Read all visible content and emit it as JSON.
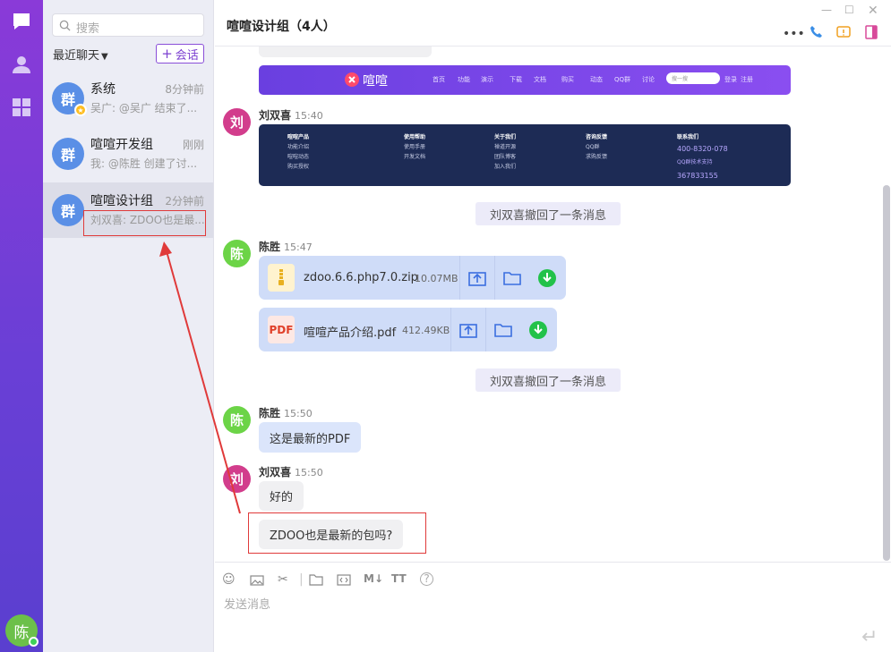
{
  "app": {
    "me_avatar": "陈"
  },
  "sidebar": {
    "search_placeholder": "搜索",
    "recent_label": "最近聊天",
    "new_chat_label": "会话",
    "conversations": [
      {
        "avatar": "群",
        "name": "系统",
        "time": "8分钟前",
        "preview": "吴广: @吴广 结束了..."
      },
      {
        "avatar": "群",
        "name": "喧喧开发组",
        "time": "刚刚",
        "preview": "我: @陈胜 创建了讨..."
      },
      {
        "avatar": "群",
        "name": "喧喧设计组",
        "time": "2分钟前",
        "preview": "刘双喜: ZDOO也是最..."
      }
    ]
  },
  "chat": {
    "title": "喧喧设计组（4人）",
    "banner": {
      "logo": "喧喧",
      "nav": [
        "首页",
        "功能",
        "演示",
        "下载",
        "文档",
        "购买",
        "动态",
        "QQ群",
        "讨论"
      ],
      "search_ph": "搜一搜",
      "login": "登录",
      "register": "注册"
    },
    "footer_cols": [
      {
        "head": "喧喧产品",
        "items": [
          "功能介绍",
          "喧喧动态",
          "购买授权"
        ]
      },
      {
        "head": "使用帮助",
        "items": [
          "使用手册",
          "开发文档"
        ]
      },
      {
        "head": "关于我们",
        "items": [
          "禅道开源",
          "团队博客",
          "加入我们"
        ]
      },
      {
        "head": "咨询反馈",
        "items": [
          "QQ群",
          "求购反馈"
        ]
      },
      {
        "head": "联系我们",
        "items": [
          "400-8320-078",
          "QQ群技术支持",
          "367833155"
        ]
      }
    ],
    "messages": {
      "m1": {
        "sender": "刘双喜",
        "time": "15:40",
        "avatar": "刘"
      },
      "recall1": "刘双喜撤回了一条消息",
      "m2": {
        "sender": "陈胜",
        "time": "15:47",
        "avatar": "陈"
      },
      "file1": {
        "name": "zdoo.6.6.php7.0.zip",
        "size": "10.07MB"
      },
      "file2": {
        "name": "喧喧产品介绍.pdf",
        "size": "412.49KB",
        "type_label": "PDF"
      },
      "recall2": "刘双喜撤回了一条消息",
      "m3": {
        "sender": "陈胜",
        "time": "15:50",
        "avatar": "陈",
        "text": "这是最新的PDF"
      },
      "m4": {
        "sender": "刘双喜",
        "time": "15:50",
        "avatar": "刘",
        "text1": "好的",
        "text2": "ZDOO也是最新的包吗?"
      }
    },
    "composer_placeholder": "发送消息"
  },
  "colors": {
    "accent": "#7b3fd0",
    "annotation": "#e03a3a"
  }
}
